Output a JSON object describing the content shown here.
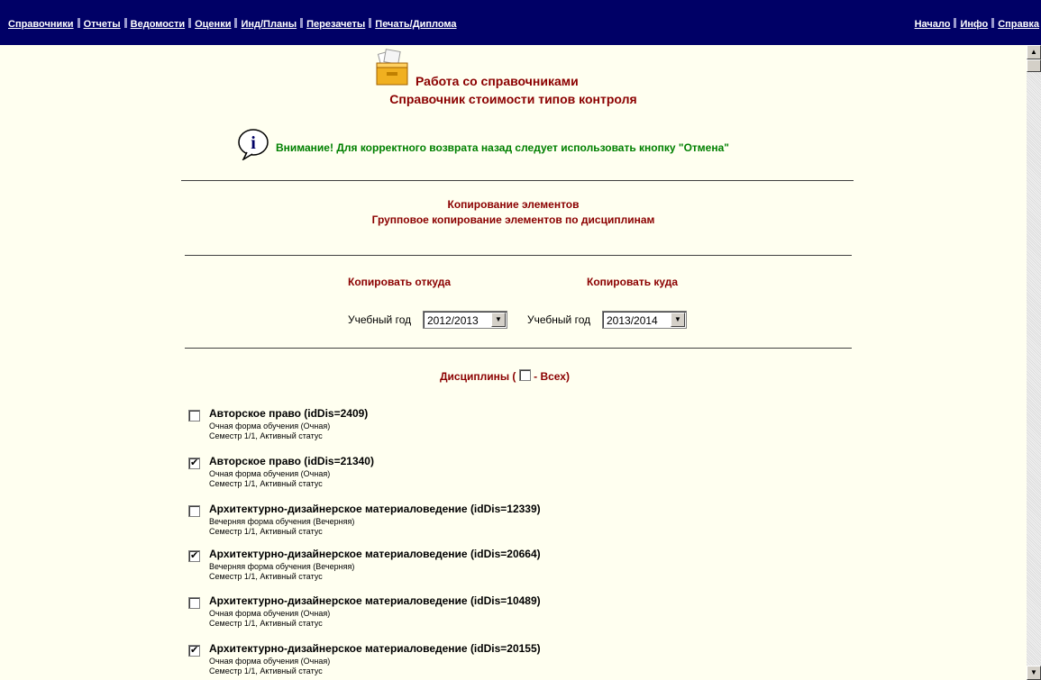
{
  "nav": {
    "left": [
      "Справочники",
      "Отчеты",
      "Ведомости",
      "Оценки",
      "Инд/Планы",
      "Перезачеты",
      "Печать/Диплома"
    ],
    "right": [
      "Начало",
      "Инфо",
      "Справка"
    ]
  },
  "header": {
    "title1": "Работа со справочниками",
    "title2": "Справочник стоимости типов контроля",
    "icon": "cabinet-icon"
  },
  "warning": {
    "icon": "info-icon",
    "text": "Внимание! Для корректного возврата назад следует использовать кнопку \"Отмена\""
  },
  "section": {
    "title1": "Копирование элементов",
    "title2": "Групповое копирование элементов по дисциплинам"
  },
  "copy": {
    "from_label": "Копировать откуда",
    "to_label": "Копировать куда",
    "from_year_label": "Учебный год",
    "from_year": "2012/2013",
    "to_year_label": "Учебный год",
    "to_year": "2013/2014"
  },
  "disciplines": {
    "title_prefix": "Дисциплины (",
    "title_suffix": "- Всех)",
    "all_checked": false,
    "items": [
      {
        "name": "Авторское право (idDis=2409)",
        "form": "Очная форма обучения (Очная)",
        "status": "Семестр 1/1, Активный статус",
        "checked": false
      },
      {
        "name": "Авторское право (idDis=21340)",
        "form": "Очная форма обучения (Очная)",
        "status": "Семестр 1/1, Активный статус",
        "checked": true
      },
      {
        "name": "Архитектурно-дизайнерское материаловедение (idDis=12339)",
        "form": "Вечерняя форма обучения (Вечерняя)",
        "status": "Семестр 1/1, Активный статус",
        "checked": false
      },
      {
        "name": "Архитектурно-дизайнерское материаловедение (idDis=20664)",
        "form": "Вечерняя форма обучения (Вечерняя)",
        "status": "Семестр 1/1, Активный статус",
        "checked": true
      },
      {
        "name": "Архитектурно-дизайнерское материаловедение (idDis=10489)",
        "form": "Очная форма обучения (Очная)",
        "status": "Семестр 1/1, Активный статус",
        "checked": false
      },
      {
        "name": "Архитектурно-дизайнерское материаловедение (idDis=20155)",
        "form": "Очная форма обучения (Очная)",
        "status": "Семестр 1/1, Активный статус",
        "checked": true
      }
    ]
  }
}
